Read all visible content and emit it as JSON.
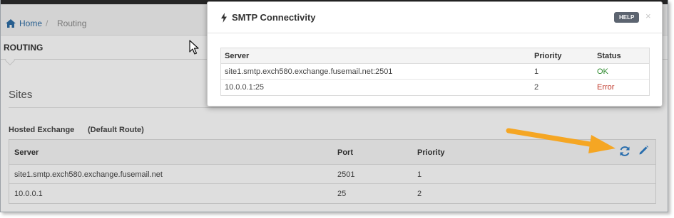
{
  "breadcrumb": {
    "home": "Home",
    "separator": "/",
    "current": "Routing"
  },
  "section": {
    "title": "ROUTING"
  },
  "sites": {
    "title": "Sites",
    "group_name": "Hosted Exchange",
    "group_tag": "(Default Route)",
    "columns": {
      "server": "Server",
      "port": "Port",
      "priority": "Priority"
    },
    "rows": [
      {
        "server": "site1.smtp.exch580.exchange.fusemail.net",
        "port": "2501",
        "priority": "1"
      },
      {
        "server": "10.0.0.1",
        "port": "25",
        "priority": "2"
      }
    ]
  },
  "modal": {
    "title": "SMTP Connectivity",
    "help_label": "HELP",
    "close_label": "×",
    "columns": {
      "server": "Server",
      "priority": "Priority",
      "status": "Status"
    },
    "rows": [
      {
        "server": "site1.smtp.exch580.exchange.fusemail.net:2501",
        "priority": "1",
        "status": "OK"
      },
      {
        "server": "10.0.0.1:25",
        "priority": "2",
        "status": "Error"
      }
    ]
  },
  "colors": {
    "link": "#2f6ea5",
    "status_ok": "#2e8a2e",
    "status_error": "#c0392b",
    "arrow": "#f5a623",
    "action_icon": "#2f7ec7"
  },
  "icons": [
    "home-icon",
    "refresh-icon",
    "edit-icon",
    "bolt-icon",
    "close-icon",
    "cursor-icon"
  ]
}
